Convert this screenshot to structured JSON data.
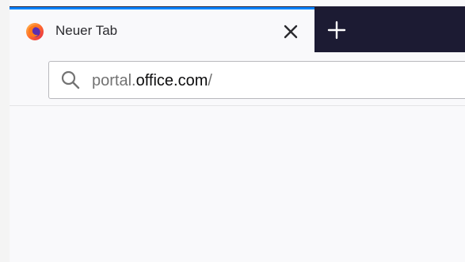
{
  "browser": {
    "tab": {
      "title": "Neuer Tab",
      "favicon_icon": "firefox-logo-icon",
      "close_icon": "close-icon",
      "active_indicator_color": "#0a84ff"
    },
    "new_tab_icon": "plus-icon",
    "address_bar": {
      "search_icon": "search-icon",
      "url_prefix": "portal.",
      "url_domain": "office.com",
      "url_suffix": "/"
    }
  },
  "colors": {
    "tabbar_background": "#1c1b33",
    "content_background": "#f9f9fb"
  }
}
